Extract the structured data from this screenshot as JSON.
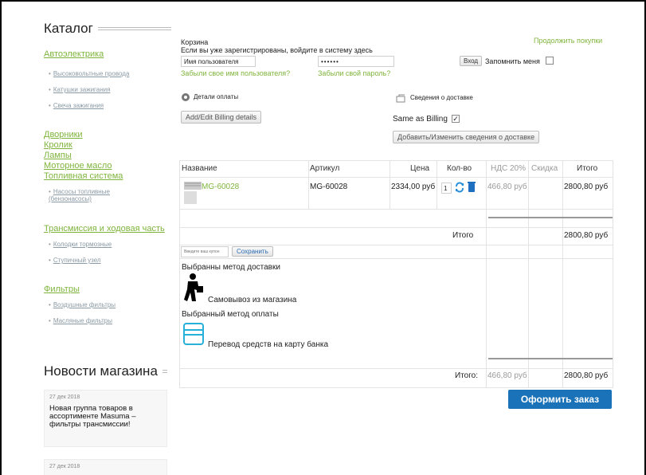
{
  "sidebar": {
    "catalog_title": "Каталог",
    "groups": [
      {
        "title": "Автоэлектрика",
        "items": [
          "Высоковольтные провода",
          "Катушки зажигания",
          "Свеча зажигания"
        ]
      },
      {
        "links": [
          "Дворники",
          "Кролик",
          "Лампы",
          "Моторное масло",
          "Топливная система"
        ],
        "items": [
          "Насосы топливные (бензонасосы)"
        ]
      },
      {
        "title": "Трансмиссия и ходовая часть",
        "items": [
          "Колодки тормозные",
          "Ступичный узел"
        ]
      },
      {
        "title": "Фильтры",
        "items": [
          "Воздушные фильтры",
          "Масляные фильтры"
        ]
      }
    ],
    "news_title": "Новости магазина",
    "news": [
      {
        "date": "27 дек 2018",
        "text": "Новая группа товаров в ассортименте Masuma – фильтры трансмиссии!"
      },
      {
        "date": "27 дек 2018",
        "text": ""
      }
    ]
  },
  "cart": {
    "title": "Корзина",
    "continue_link": "Продолжить покупки",
    "login_prompt": "Если вы уже зарегистрированы, войдите в систему здесь",
    "username_value": "Имя пользователя",
    "password_value": "••••••",
    "login_button": "Вход",
    "remember_label": "Запомнить меня",
    "forgot_username": "Забыли свое имя пользователя?",
    "forgot_password": "Забыли свой пароль?",
    "billing_title": "Детали оплаты",
    "billing_button": "Add/Edit Billing details",
    "shipping_title": "Сведения о доставке",
    "same_as_billing": "Same as Billing",
    "shipping_button": "Добавить/Изменить сведения о доставке"
  },
  "table": {
    "headers": [
      "Название",
      "Артикул",
      "Цена",
      "Кол-во",
      "НДС 20%",
      "Скидка",
      "Итого"
    ],
    "row": {
      "name": "MG-60028",
      "sku": "MG-60028",
      "price": "2334,00 руб",
      "qty": "1",
      "vat": "466,80 руб",
      "total": "2800,80 руб"
    },
    "subtotal_label": "Итого",
    "subtotal_value": "2800,80 руб",
    "coupon_placeholder": "Введите ваш купон",
    "save_button": "Сохранить",
    "shipping_method_label": "Выбранны метод доставки",
    "shipping_method": "Самовывоз из магазина",
    "payment_method_label": "Выбранный метод оплаты",
    "payment_method": "Перевод средств на карту банка",
    "grand_label": "Итого:",
    "grand_vat": "466,80 руб",
    "grand_total": "2800,80 руб"
  },
  "order_button": "Оформить заказ",
  "colors": {
    "link_green": "#7fb43c",
    "order_blue": "#1a72b8"
  }
}
